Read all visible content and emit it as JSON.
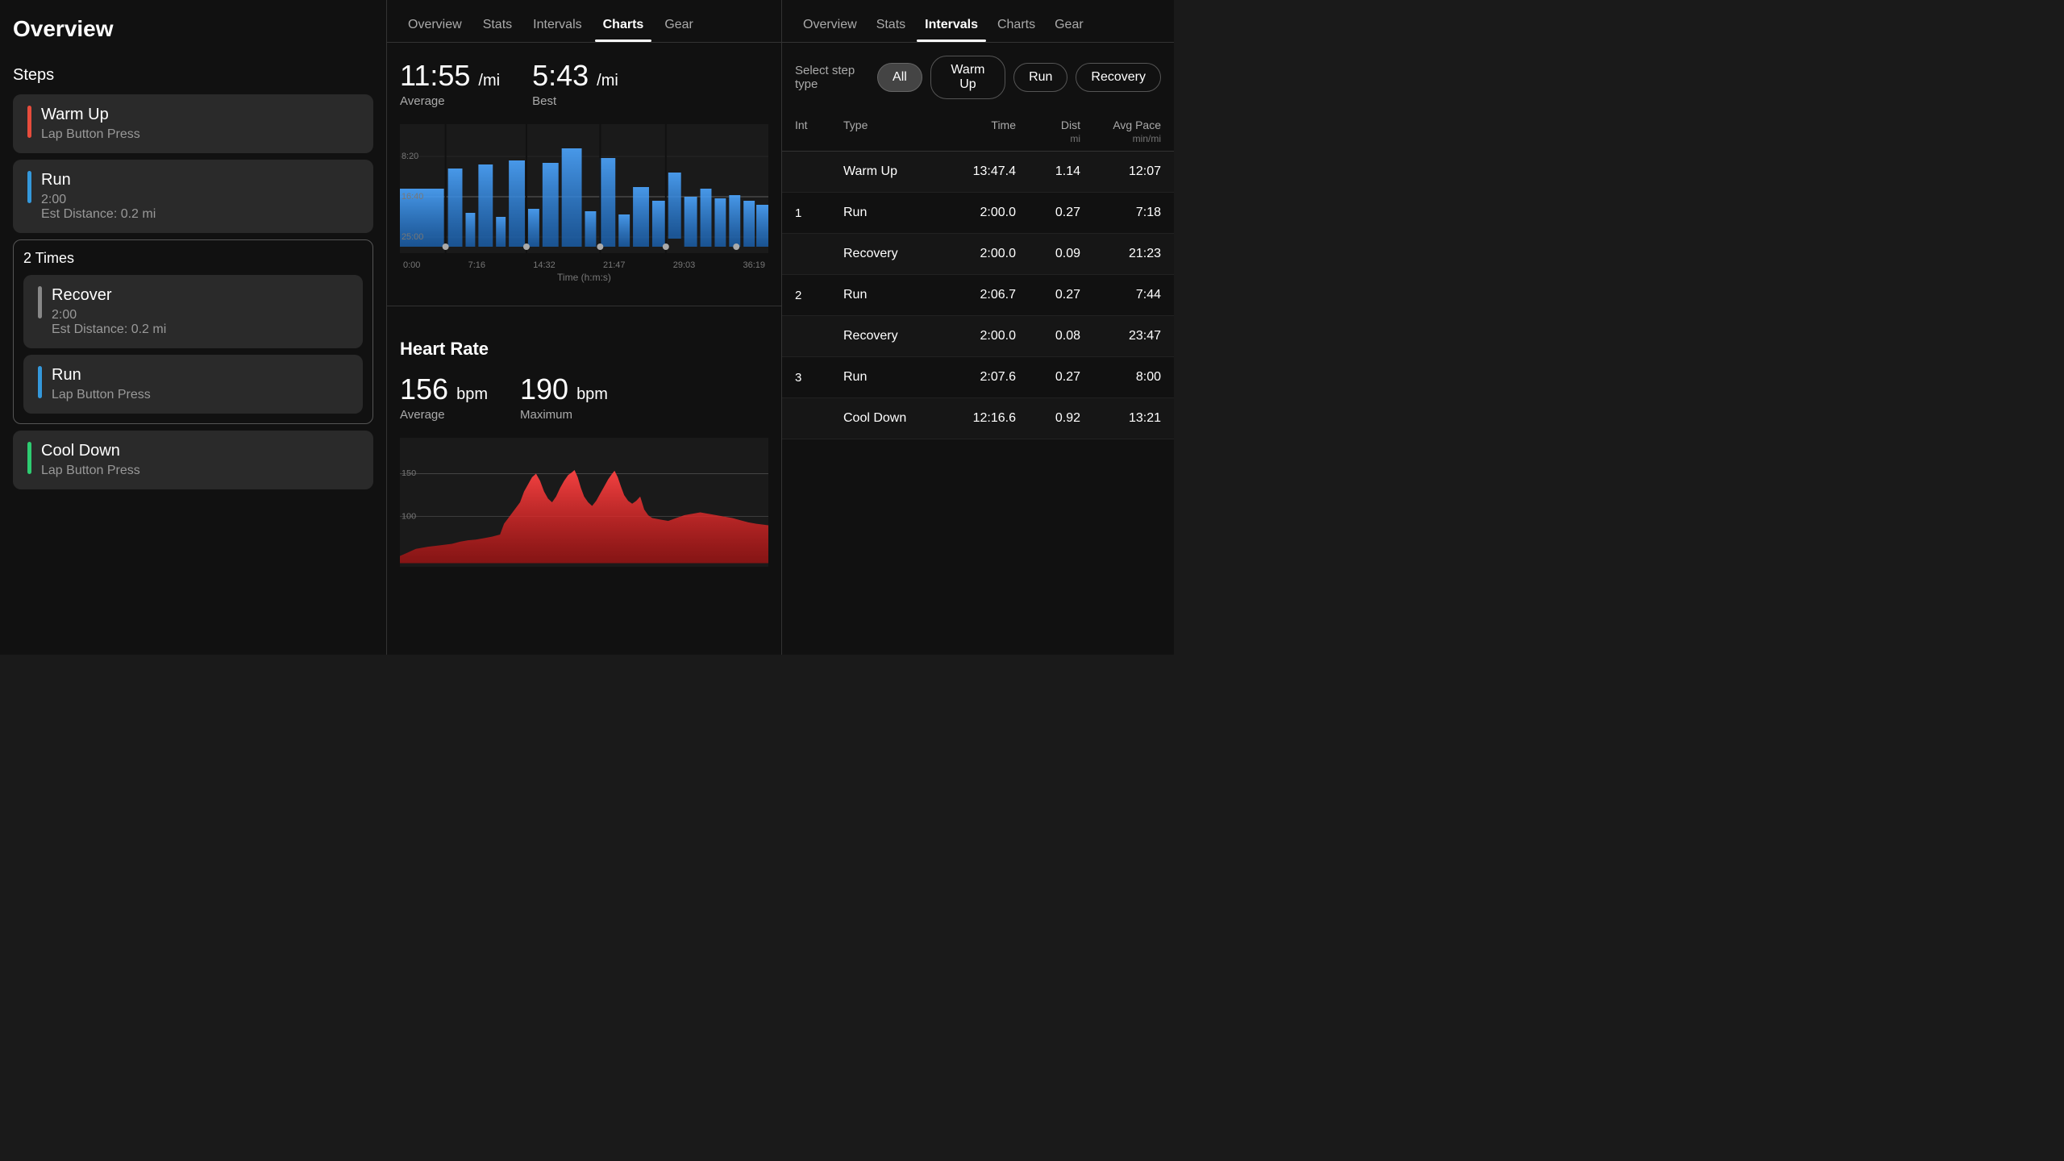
{
  "panel1": {
    "title": "Overview",
    "steps_label": "Steps",
    "steps": [
      {
        "name": "Warm Up",
        "detail": "Lap Button Press",
        "color": "#e74c3c"
      },
      {
        "name": "Run",
        "detail1": "2:00",
        "detail2": "Est Distance: 0.2 mi",
        "color": "#3498db"
      }
    ],
    "repeat": {
      "label": "2 Times",
      "items": [
        {
          "name": "Recover",
          "detail1": "2:00",
          "detail2": "Est Distance: 0.2 mi",
          "color": "#888"
        },
        {
          "name": "Run",
          "detail": "Lap Button Press",
          "color": "#3498db"
        }
      ]
    },
    "cooldown": {
      "name": "Cool Down",
      "detail": "Lap Button Press",
      "color": "#2ecc71"
    }
  },
  "panel2": {
    "tabs": [
      "Overview",
      "Stats",
      "Intervals",
      "Charts",
      "Gear"
    ],
    "active_tab": "Charts",
    "pace": {
      "avg_value": "11:55",
      "avg_unit": "/mi",
      "avg_label": "Average",
      "best_value": "5:43",
      "best_unit": "/mi",
      "best_label": "Best"
    },
    "chart_y_labels": [
      "8:20",
      "16:40",
      "25:00"
    ],
    "chart_x_labels": [
      "0:00",
      "7:16",
      "14:32",
      "21:47",
      "29:03",
      "36:19"
    ],
    "chart_x_title": "Time (h:m:s)",
    "heart_rate": {
      "title": "Heart Rate",
      "avg_value": "156",
      "avg_unit": "bpm",
      "avg_label": "Average",
      "max_value": "190",
      "max_unit": "bpm",
      "max_label": "Maximum"
    },
    "hr_y_labels": [
      "100",
      "150"
    ]
  },
  "panel3": {
    "tabs": [
      "Overview",
      "Stats",
      "Intervals",
      "Charts",
      "Gear"
    ],
    "active_tab": "Intervals",
    "select_label": "Select step type",
    "filters": [
      "All",
      "Warm Up",
      "Run",
      "Recovery"
    ],
    "active_filter": "All",
    "table": {
      "headers": {
        "int": "Int",
        "type": "Type",
        "time": "Time",
        "dist": "Dist",
        "dist_unit": "mi",
        "avg_pace": "Avg Pace",
        "avg_pace_unit": "min/mi"
      },
      "rows": [
        {
          "int": "",
          "type": "Warm Up",
          "time": "13:47.4",
          "dist": "1.14",
          "avg_pace": "12:07"
        },
        {
          "int": "1",
          "type": "Run",
          "time": "2:00.0",
          "dist": "0.27",
          "avg_pace": "7:18"
        },
        {
          "int": "",
          "type": "Recovery",
          "time": "2:00.0",
          "dist": "0.09",
          "avg_pace": "21:23"
        },
        {
          "int": "2",
          "type": "Run",
          "time": "2:06.7",
          "dist": "0.27",
          "avg_pace": "7:44"
        },
        {
          "int": "",
          "type": "Recovery",
          "time": "2:00.0",
          "dist": "0.08",
          "avg_pace": "23:47"
        },
        {
          "int": "3",
          "type": "Run",
          "time": "2:07.6",
          "dist": "0.27",
          "avg_pace": "8:00"
        },
        {
          "int": "",
          "type": "Cool Down",
          "time": "12:16.6",
          "dist": "0.92",
          "avg_pace": "13:21"
        }
      ]
    }
  }
}
